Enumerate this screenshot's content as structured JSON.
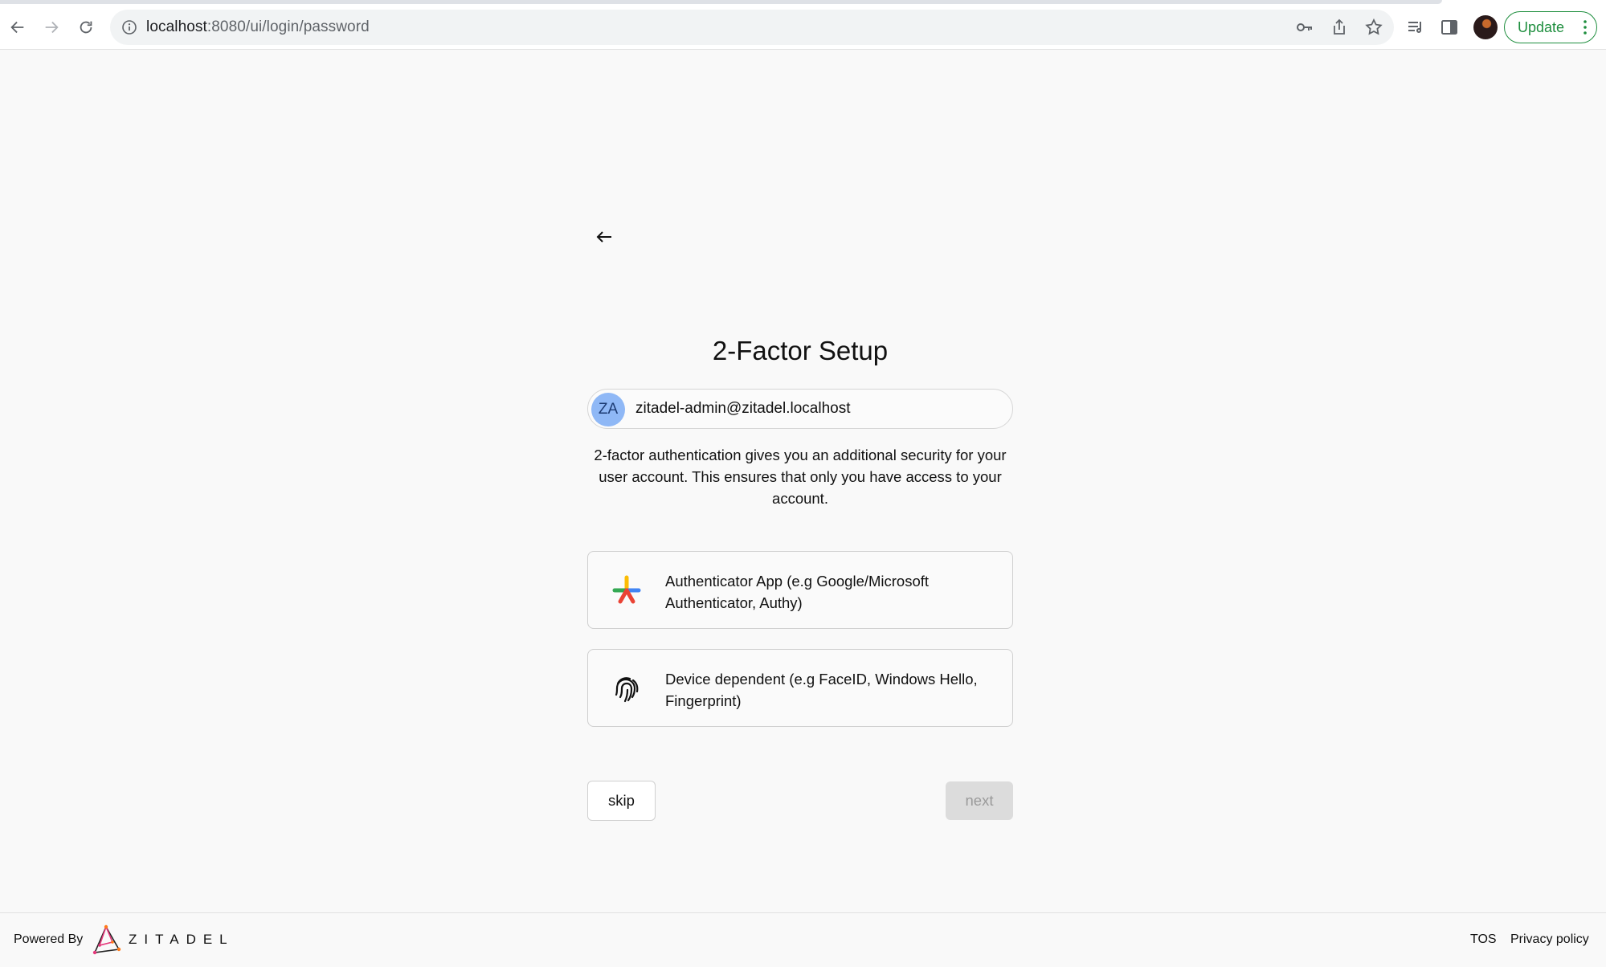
{
  "browser": {
    "url_host": "localhost",
    "url_path": ":8080/ui/login/password",
    "update_label": "Update"
  },
  "page": {
    "title": "2-Factor Setup",
    "user": {
      "initials": "ZA",
      "email": "zitadel-admin@zitadel.localhost"
    },
    "description": "2-factor authentication gives you an additional security for your user account. This ensures that only you have access to your account.",
    "options": [
      {
        "label": "Authenticator App (e.g Google/Microsoft Authenticator, Authy)",
        "icon": "authenticator-asterisk-icon"
      },
      {
        "label": "Device dependent (e.g FaceID, Windows Hello, Fingerprint)",
        "icon": "fingerprint-icon"
      }
    ],
    "skip_label": "skip",
    "next_label": "next"
  },
  "footer": {
    "powered_by": "Powered By",
    "logo_text": "ZITADEL",
    "tos": "TOS",
    "privacy": "Privacy policy"
  },
  "colors": {
    "update_green": "#1e8e3e",
    "avatar_blue": "#8fb8f6"
  }
}
